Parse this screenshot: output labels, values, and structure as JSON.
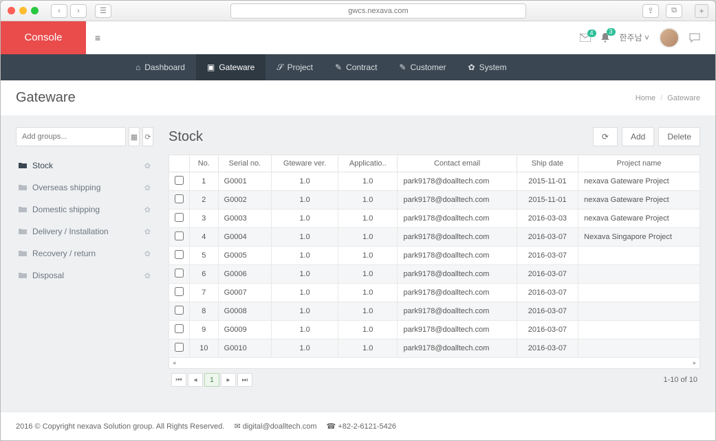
{
  "browser": {
    "url": "gwcs.nexava.com"
  },
  "brand": "Console",
  "notifications": {
    "mail_count": "4",
    "bell_count": "3"
  },
  "user": {
    "name": "한주남",
    "caret": "˅"
  },
  "nav": {
    "dashboard": "Dashboard",
    "gateware": "Gateware",
    "project": "Project",
    "contract": "Contract",
    "customer": "Customer",
    "system": "System"
  },
  "page": {
    "title": "Gateware",
    "breadcrumb_home": "Home",
    "breadcrumb_current": "Gateware"
  },
  "sidebar": {
    "add_placeholder": "Add groups...",
    "items": [
      {
        "label": "Stock"
      },
      {
        "label": "Overseas shipping"
      },
      {
        "label": "Domestic shipping"
      },
      {
        "label": "Delivery / Installation"
      },
      {
        "label": "Recovery / return"
      },
      {
        "label": "Disposal"
      }
    ]
  },
  "main": {
    "heading": "Stock",
    "actions": {
      "add": "Add",
      "delete": "Delete"
    },
    "columns": {
      "no": "No.",
      "serial": "Serial no.",
      "gver": "Gteware ver.",
      "appver": "Applicatio..",
      "email": "Contact email",
      "ship": "Ship date",
      "project": "Project name"
    },
    "rows": [
      {
        "no": "1",
        "serial": "G0001",
        "gver": "1.0",
        "appver": "1.0",
        "email": "park9178@doalltech.com",
        "ship": "2015-11-01",
        "project": "nexava Gateware Project"
      },
      {
        "no": "2",
        "serial": "G0002",
        "gver": "1.0",
        "appver": "1.0",
        "email": "park9178@doalltech.com",
        "ship": "2015-11-01",
        "project": "nexava Gateware Project"
      },
      {
        "no": "3",
        "serial": "G0003",
        "gver": "1.0",
        "appver": "1.0",
        "email": "park9178@doalltech.com",
        "ship": "2016-03-03",
        "project": "nexava Gateware Project"
      },
      {
        "no": "4",
        "serial": "G0004",
        "gver": "1.0",
        "appver": "1.0",
        "email": "park9178@doalltech.com",
        "ship": "2016-03-07",
        "project": "Nexava Singapore Project"
      },
      {
        "no": "5",
        "serial": "G0005",
        "gver": "1.0",
        "appver": "1.0",
        "email": "park9178@doalltech.com",
        "ship": "2016-03-07",
        "project": ""
      },
      {
        "no": "6",
        "serial": "G0006",
        "gver": "1.0",
        "appver": "1.0",
        "email": "park9178@doalltech.com",
        "ship": "2016-03-07",
        "project": ""
      },
      {
        "no": "7",
        "serial": "G0007",
        "gver": "1.0",
        "appver": "1.0",
        "email": "park9178@doalltech.com",
        "ship": "2016-03-07",
        "project": ""
      },
      {
        "no": "8",
        "serial": "G0008",
        "gver": "1.0",
        "appver": "1.0",
        "email": "park9178@doalltech.com",
        "ship": "2016-03-07",
        "project": ""
      },
      {
        "no": "9",
        "serial": "G0009",
        "gver": "1.0",
        "appver": "1.0",
        "email": "park9178@doalltech.com",
        "ship": "2016-03-07",
        "project": ""
      },
      {
        "no": "10",
        "serial": "G0010",
        "gver": "1.0",
        "appver": "1.0",
        "email": "park9178@doalltech.com",
        "ship": "2016-03-07",
        "project": ""
      }
    ],
    "pager": {
      "page": "1",
      "info": "1-10 of 10"
    }
  },
  "footer": {
    "copyright": "2016 © Copyright nexava Solution group. All Rights Reserved.",
    "email": "digital@doalltech.com",
    "phone": "+82-2-6121-5426"
  }
}
